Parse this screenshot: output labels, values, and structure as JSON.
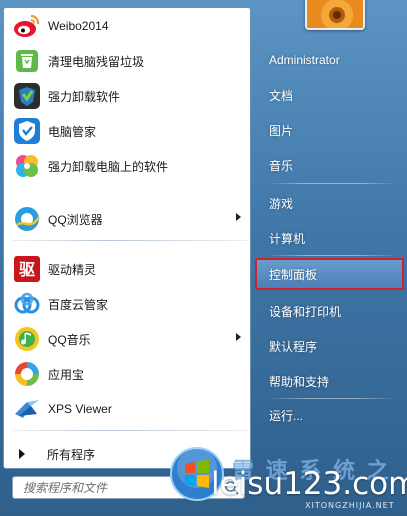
{
  "pinned": [
    {
      "label": "Weibo2014",
      "icon": "weibo-icon",
      "has_arrow": false
    },
    {
      "label": "清理电脑残留垃圾",
      "icon": "recycle-bin-icon",
      "has_arrow": false
    },
    {
      "label": "强力卸载软件",
      "icon": "uninstaller-icon",
      "has_arrow": false
    },
    {
      "label": "电脑管家",
      "icon": "pc-manager-shield-icon",
      "has_arrow": false
    },
    {
      "label": "强力卸载电脑上的软件",
      "icon": "colorful-clover-icon",
      "has_arrow": false
    },
    {
      "label": "QQ浏览器",
      "icon": "qq-browser-icon",
      "has_arrow": true
    }
  ],
  "recent": [
    {
      "label": "驱动精灵",
      "icon": "driver-genius-icon",
      "has_arrow": false
    },
    {
      "label": "百度云管家",
      "icon": "baidu-cloud-icon",
      "has_arrow": false
    },
    {
      "label": "QQ音乐",
      "icon": "qq-music-icon",
      "has_arrow": true
    },
    {
      "label": "应用宝",
      "icon": "app-store-icon",
      "has_arrow": false
    },
    {
      "label": "XPS Viewer",
      "icon": "xps-viewer-icon",
      "has_arrow": false
    }
  ],
  "all_programs_label": "所有程序",
  "search": {
    "placeholder": "搜索程序和文件"
  },
  "right_links": [
    {
      "label": "Administrator"
    },
    {
      "label": "文档"
    },
    {
      "label": "图片"
    },
    {
      "label": "音乐"
    },
    {
      "label": "游戏"
    },
    {
      "label": "计算机"
    },
    {
      "label": "控制面板",
      "highlighted": true
    },
    {
      "label": "设备和打印机"
    },
    {
      "label": "默认程序"
    },
    {
      "label": "帮助和支持"
    },
    {
      "label": "运行..."
    }
  ],
  "watermark": {
    "cn": "雷 速 系 统 之",
    "site": "leisu123.com",
    "small": "XITONGZHIJIA.NET"
  },
  "colors": {
    "highlight_border": "#d1202a",
    "taskbar_blue": "#3f77a8"
  }
}
